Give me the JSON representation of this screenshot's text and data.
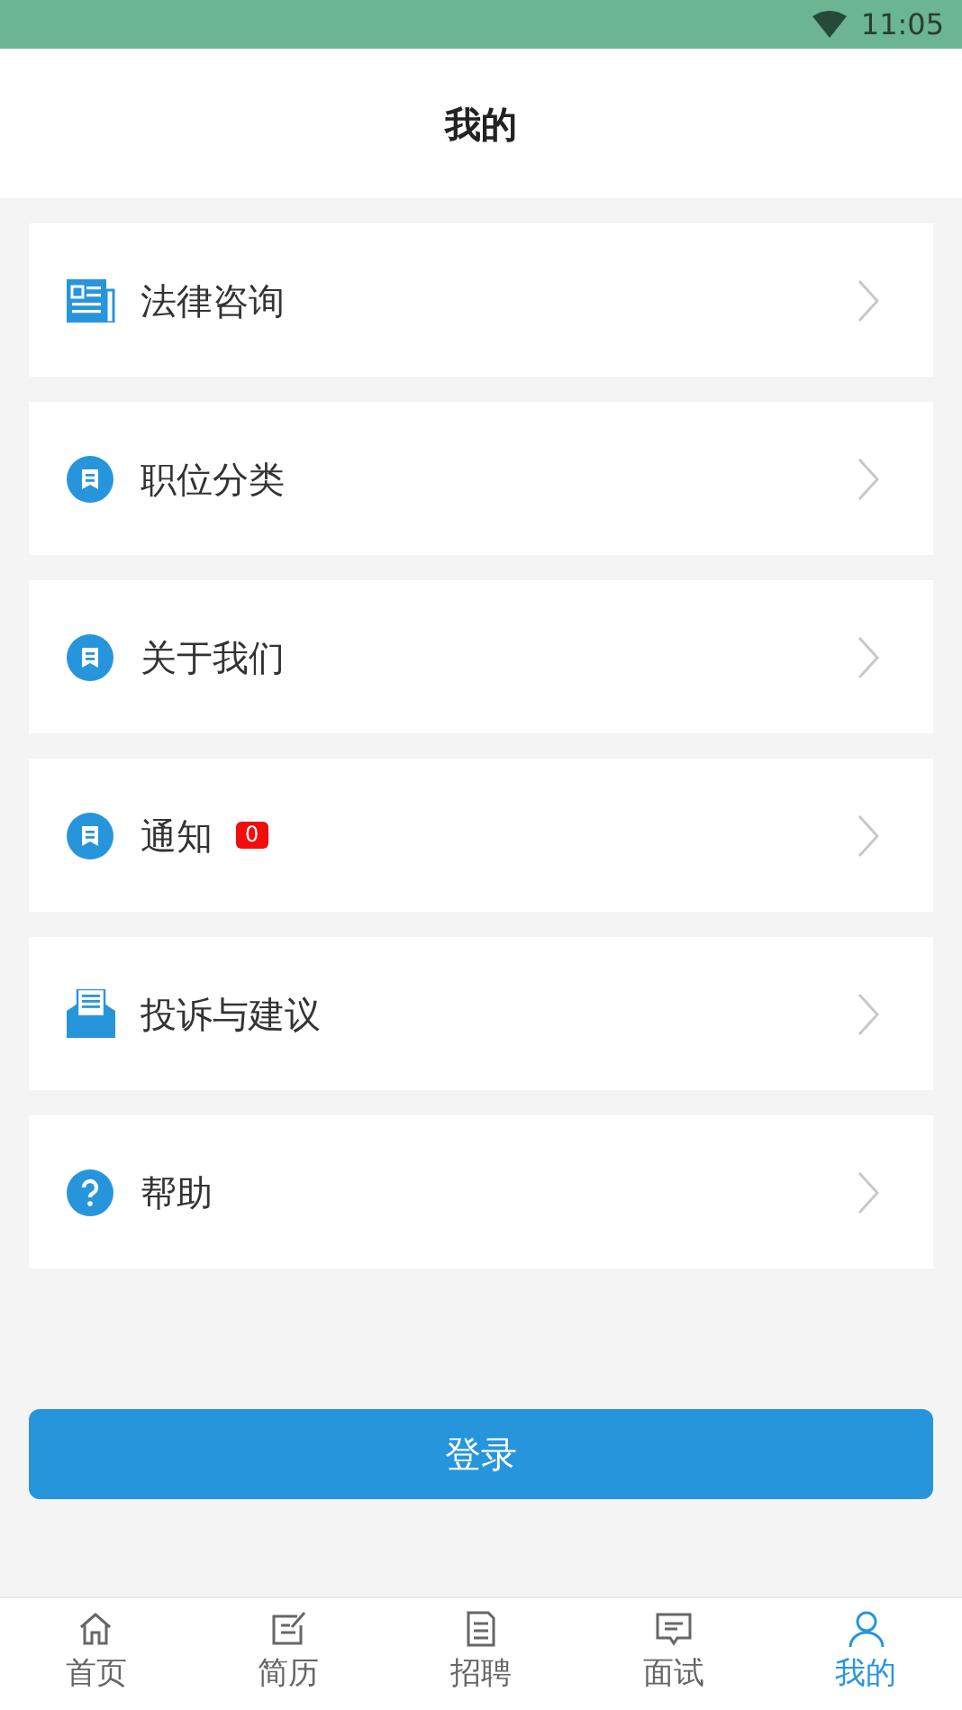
{
  "status_bar": {
    "time": "11:05"
  },
  "header": {
    "title": "我的"
  },
  "menu": [
    {
      "kind": "newspaper",
      "label": "法律咨询"
    },
    {
      "kind": "bookmark",
      "label": "职位分类"
    },
    {
      "kind": "bookmark",
      "label": "关于我们"
    },
    {
      "kind": "bookmark",
      "label": "通知",
      "badge": "0"
    },
    {
      "kind": "mail",
      "label": "投诉与建议"
    },
    {
      "kind": "help",
      "label": "帮助"
    }
  ],
  "login_button": "登录",
  "tabs": [
    {
      "kind": "home",
      "label": "首页",
      "selected": false
    },
    {
      "kind": "resume",
      "label": "简历",
      "selected": false
    },
    {
      "kind": "document",
      "label": "招聘",
      "selected": false
    },
    {
      "kind": "chat",
      "label": "面试",
      "selected": false
    },
    {
      "kind": "person",
      "label": "我的",
      "selected": true
    }
  ]
}
